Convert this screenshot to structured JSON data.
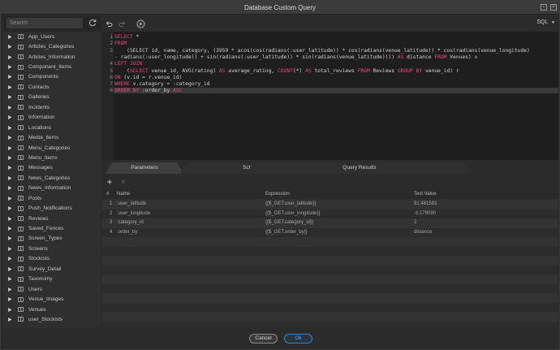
{
  "window": {
    "title": "Database Custom Query"
  },
  "search": {
    "placeholder": "Search"
  },
  "toolbar": {
    "language": "SQL"
  },
  "tables": [
    "App_Users",
    "Articles_Categories",
    "Articles_Information",
    "Component_Items",
    "Components",
    "Contacts",
    "Galleries",
    "Incidents",
    "Information",
    "Locations",
    "Media_Items",
    "Menu_Categories",
    "Menu_Items",
    "Messages",
    "News_Categories",
    "News_Information",
    "Posts",
    "Push_Notifications",
    "Reviews",
    "Saved_Fences",
    "Screen_Types",
    "Screens",
    "Stockists",
    "Survey_Detail",
    "Taxonomy",
    "Users",
    "Venue_Images",
    "Venues",
    "user_Stockists"
  ],
  "editor": {
    "line_numbers": [
      "1",
      "2",
      "3",
      "",
      "4",
      "5",
      "6",
      "7",
      "8"
    ],
    "lines": [
      [
        {
          "k": "SELECT"
        },
        {
          "t": " *"
        }
      ],
      [
        {
          "k": "FROM"
        }
      ],
      [
        {
          "t": "    (SELECT id, name, category, (3959 * acos(cos(radians(:user_latitude)) * cos(radians(venue_latitude)) * cos(radians(venue_longitude)"
        }
      ],
      [
        {
          "t": "- radians(:user_longitude)) + sin(radians(:user_latitude)) * sin(radians(venue_latitude)))) "
        },
        {
          "k": "AS"
        },
        {
          "t": " distance "
        },
        {
          "k": "FROM"
        },
        {
          "t": " Venues) v"
        }
      ],
      [
        {
          "k": "LEFT JOIN"
        }
      ],
      [
        {
          "t": "    ("
        },
        {
          "k": "SELECT"
        },
        {
          "t": " venue_id, AVG(rating) "
        },
        {
          "k": "AS"
        },
        {
          "t": " average_rating, "
        },
        {
          "k": "COUNT"
        },
        {
          "t": "(*) "
        },
        {
          "k": "AS"
        },
        {
          "t": " total_reviews "
        },
        {
          "k": "FROM"
        },
        {
          "t": " Reviews "
        },
        {
          "k": "GROUP BY"
        },
        {
          "t": " venue_id) r"
        }
      ],
      [
        {
          "k": "ON"
        },
        {
          "t": " (v.id = r.venue_id)"
        }
      ],
      [
        {
          "k": "WHERE"
        },
        {
          "t": " v.category = :category_id"
        }
      ],
      [
        {
          "k": "ORDER BY"
        },
        {
          "t": " :order_by "
        },
        {
          "k": "ASC"
        }
      ]
    ]
  },
  "tabs": [
    "Parameters",
    "Schema",
    "Query Results"
  ],
  "grid": {
    "headers": [
      "#",
      "Name",
      "Expression",
      "Test Value"
    ],
    "rows": [
      [
        "1",
        ":user_latitude",
        "{{$_GET.user_latitude}}",
        "51.481583"
      ],
      [
        "2",
        ":user_longitude",
        "{{$_GET.user_longitude}}",
        "-3.179090"
      ],
      [
        "3",
        ":category_id",
        "{{$_GET.category_id}}",
        "2"
      ],
      [
        "4",
        ":order_by",
        "{{$_GET.order_by}}",
        "distance"
      ]
    ]
  },
  "footer": {
    "cancel": "Cancel",
    "ok": "Ok"
  },
  "colors": {
    "keyword": "#f0477a",
    "ok_border": "#2f86d6"
  }
}
